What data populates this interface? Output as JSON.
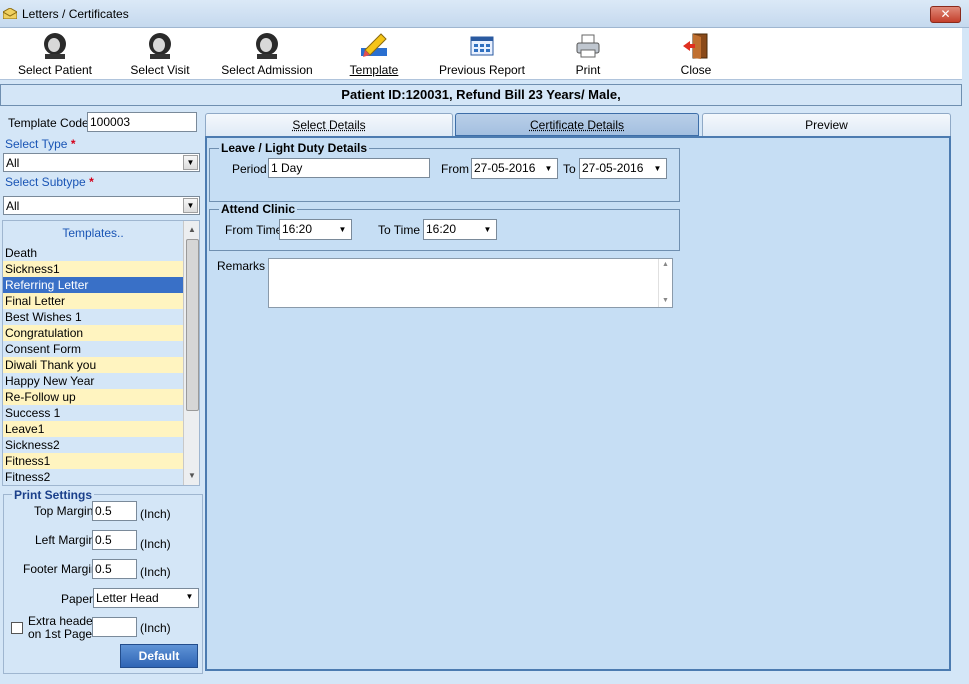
{
  "window": {
    "title": "Letters / Certificates",
    "close_glyph": "✕"
  },
  "toolbar": {
    "items": [
      {
        "label": "Select Patient",
        "icon": "patient-icon"
      },
      {
        "label": "Select Visit",
        "icon": "visit-icon"
      },
      {
        "label": "Select Admission",
        "icon": "admission-icon"
      },
      {
        "label": "Template",
        "icon": "template-icon"
      },
      {
        "label": "Previous Report",
        "icon": "report-icon"
      },
      {
        "label": "Print",
        "icon": "printer-icon"
      },
      {
        "label": "Close",
        "icon": "exit-door-icon"
      }
    ]
  },
  "patient_band": "Patient ID:120031, Refund Bill  23 Years/ Male,",
  "left": {
    "template_code_label": "Template Code",
    "template_code_value": "100003",
    "select_type_label": "Select Type",
    "select_type_value": "All",
    "select_subtype_label": "Select Subtype",
    "select_subtype_value": "All",
    "required_mark": "*",
    "templates_header": "Templates..",
    "templates": [
      {
        "name": "Death",
        "style": "b"
      },
      {
        "name": "Sickness1",
        "style": "y"
      },
      {
        "name": "Referring Letter",
        "style": "sel"
      },
      {
        "name": "Final Letter",
        "style": "y"
      },
      {
        "name": "Best Wishes 1",
        "style": "b"
      },
      {
        "name": "Congratulation",
        "style": "y"
      },
      {
        "name": "Consent Form",
        "style": "b"
      },
      {
        "name": "Diwali Thank you",
        "style": "y"
      },
      {
        "name": "Happy New Year",
        "style": "b"
      },
      {
        "name": "Re-Follow  up",
        "style": "y"
      },
      {
        "name": "Success 1",
        "style": "b"
      },
      {
        "name": "Leave1",
        "style": "y"
      },
      {
        "name": "Sickness2",
        "style": "b"
      },
      {
        "name": "Fitness1",
        "style": "y"
      },
      {
        "name": "Fitness2",
        "style": "b"
      }
    ]
  },
  "print_settings": {
    "title": "Print Settings",
    "top_margin_label": "Top Margin",
    "top_margin_value": "0.5",
    "left_margin_label": "Left Margin",
    "left_margin_value": "0.5",
    "footer_margin_label": "Footer Margin",
    "footer_margin_value": "0.5",
    "unit": "(Inch)",
    "paper_label": "Paper",
    "paper_value": "Letter Head",
    "extra_header_label_1": "Extra header",
    "extra_header_label_2": "on 1st Page",
    "extra_header_value": "",
    "default_button": "Default"
  },
  "tabs": [
    {
      "label": "Select Details",
      "active": false
    },
    {
      "label": "Certificate Details",
      "active": true
    },
    {
      "label": "Preview",
      "active": false
    }
  ],
  "certificate": {
    "leave_group_title": "Leave / Light Duty Details",
    "period_label": "Period",
    "period_value": "1 Day",
    "from_label": "From",
    "from_value": "27-05-2016",
    "to_label": "To",
    "to_value": "27-05-2016",
    "clinic_group_title": "Attend Clinic",
    "from_time_label": "From Time",
    "from_time_value": "16:20",
    "to_time_label": "To Time",
    "to_time_value": "16:20",
    "remarks_label": "Remarks",
    "remarks_value": ""
  }
}
